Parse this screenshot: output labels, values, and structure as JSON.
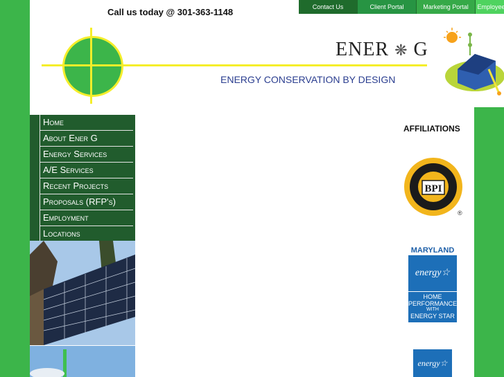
{
  "header": {
    "call_text": "Call us today @ 301-363-1148",
    "brand_name_a": "ENER",
    "brand_name_b": "G",
    "tagline": "ENERGY CONSERVATION BY DESIGN"
  },
  "topnav": [
    {
      "label": "Contact Us"
    },
    {
      "label": "Client Portal"
    },
    {
      "label": "Marketing Portal"
    },
    {
      "label": "Employee"
    }
  ],
  "sidebar": {
    "items": [
      {
        "label": "Home"
      },
      {
        "label": "About Ener G"
      },
      {
        "label": "Energy Services"
      },
      {
        "label": "A/E Services"
      },
      {
        "label": "Recent Projects"
      },
      {
        "label": "Proposals (RFP's)"
      },
      {
        "label": "Employment"
      },
      {
        "label": "Locations"
      }
    ]
  },
  "affiliations": {
    "title": "AFFILIATIONS",
    "bpi_text": "BPI",
    "md_title": "MARYLAND",
    "md_energy": "energy",
    "md_line1": "HOME",
    "md_line2": "PERFORMANCE",
    "md_line3": "WITH",
    "md_line4": "ENERGY STAR",
    "registered": "®"
  },
  "colors": {
    "background_green": "#3cb54a",
    "sidebar_green": "#215c2d",
    "accent_yellow": "#f5ee2a",
    "tagline_blue": "#2a3d8f"
  }
}
